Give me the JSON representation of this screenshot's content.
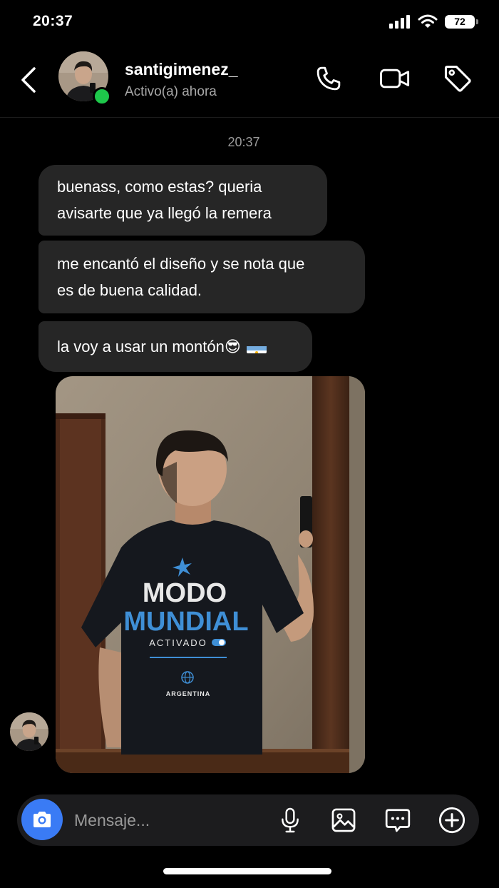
{
  "status_bar": {
    "time": "20:37",
    "battery": "72"
  },
  "header": {
    "contact_name": "santigimenez_",
    "activity": "Activo(a) ahora"
  },
  "chat": {
    "timestamp": "20:37",
    "messages": [
      {
        "lines": [
          "buenass, como estas? queria",
          "avisarte que ya llegó la remera"
        ]
      },
      {
        "lines": [
          "me encantó el diseño y se nota que",
          "es de buena calidad."
        ]
      },
      {
        "text": "la voy a usar un montón",
        "emoji": "😎"
      }
    ],
    "photo": {
      "shirt_line1": "MODO",
      "shirt_line2": "MUNDIAL",
      "shirt_line3": "ACTIVADO",
      "shirt_line4": "ARGENTINA"
    }
  },
  "composer": {
    "placeholder": "Mensaje..."
  },
  "colors": {
    "accent": "#3a7bf5",
    "online": "#1ec84b",
    "bubble": "#262626",
    "shirt_blue": "#3f8fd6"
  }
}
